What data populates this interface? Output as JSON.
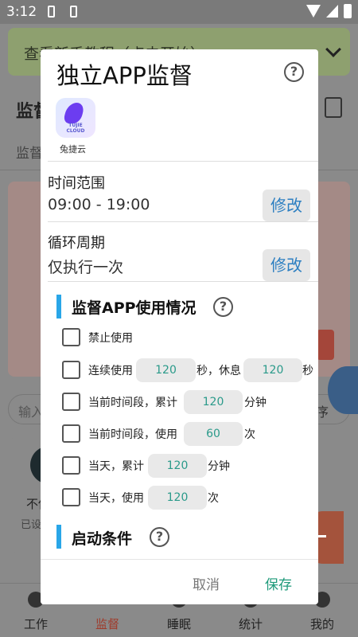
{
  "status_bar": {
    "time": "3:12"
  },
  "background": {
    "banner_text": "查看新手教程（点击开始）",
    "page_title": "监督",
    "tab1": "监督",
    "search_placeholder": "输入",
    "search_right": "序",
    "card_text": "不使",
    "card_subtext": "已设",
    "nav": [
      {
        "label": "工作"
      },
      {
        "label": "监督"
      },
      {
        "label": "睡眠"
      },
      {
        "label": "统计"
      },
      {
        "label": "我的"
      }
    ]
  },
  "dialog": {
    "title": "独立APP监督",
    "app": {
      "name": "兔捷云",
      "brand_line1": "TUJIE",
      "brand_line2": "CLOUD"
    },
    "time_range": {
      "label": "时间范围",
      "value": "09:00 - 19:00",
      "edit": "修改"
    },
    "cycle": {
      "label": "循环周期",
      "value": "仅执行一次",
      "edit": "修改"
    },
    "usage_section": {
      "title": "监督APP使用情况"
    },
    "options": {
      "opt1": {
        "text": "禁止使用"
      },
      "opt2": {
        "t1": "连续使用",
        "v1": "120",
        "t2": "秒，休息",
        "v2": "120",
        "t3": "秒"
      },
      "opt3": {
        "t1": "当前时间段，累计",
        "v1": "120",
        "t2": "分钟"
      },
      "opt4": {
        "t1": "当前时间段，使用",
        "v1": "60",
        "t2": "次"
      },
      "opt5": {
        "t1": "当天，累计",
        "v1": "120",
        "t2": "分钟"
      },
      "opt6": {
        "t1": "当天，使用",
        "v1": "120",
        "t2": "次"
      }
    },
    "start_section": {
      "title": "启动条件"
    },
    "cancel": "取消",
    "save": "保存"
  }
}
